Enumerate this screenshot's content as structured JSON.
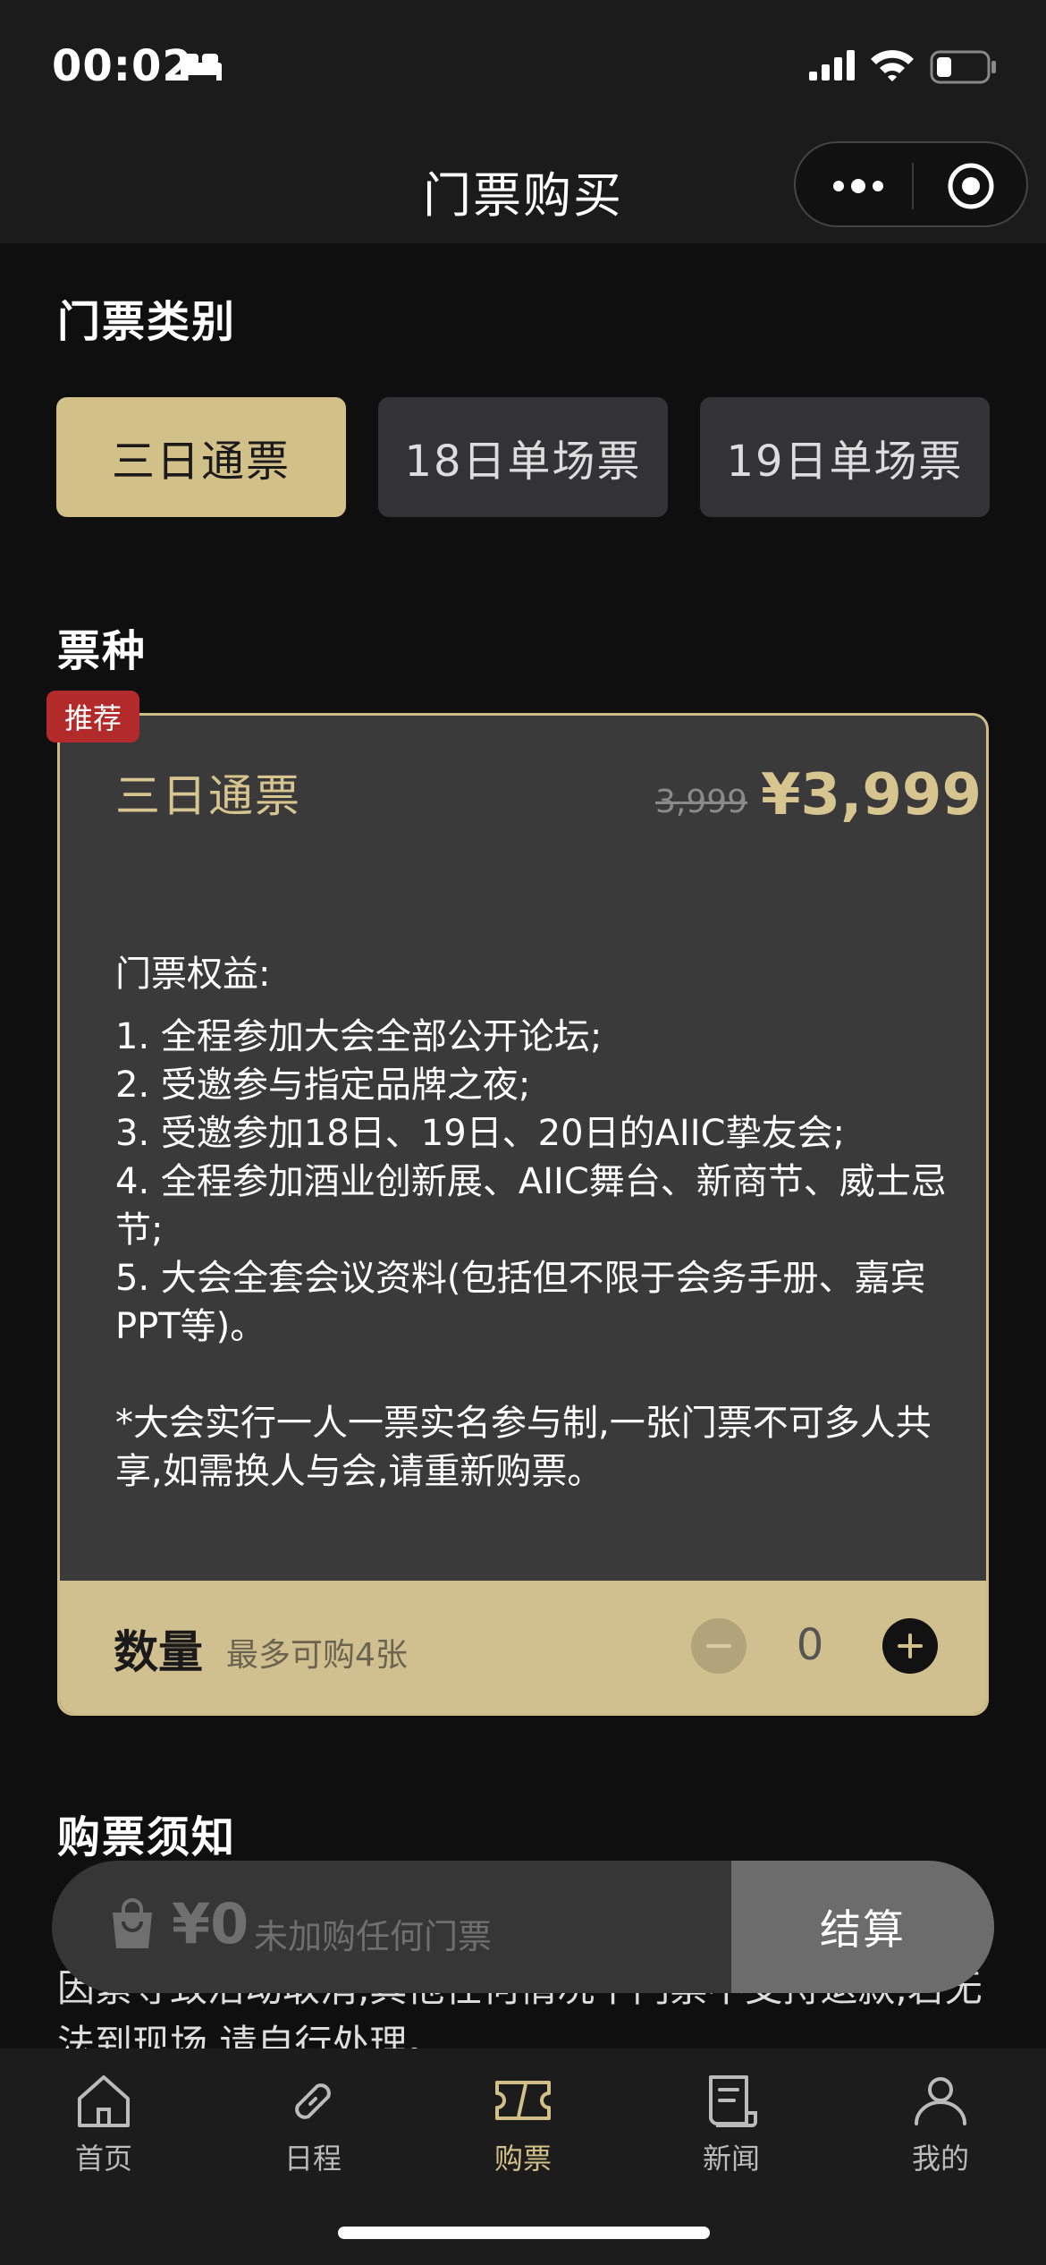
{
  "status": {
    "time": "00:02"
  },
  "nav": {
    "title": "门票购买"
  },
  "category": {
    "title": "门票类别",
    "buttons": [
      "三日通票",
      "18日单场票",
      "19日单场票"
    ]
  },
  "ticket_type": {
    "title": "票种"
  },
  "ticket": {
    "badge": "推荐",
    "name": "三日通票",
    "original_price": "3,999",
    "price": "¥3,999",
    "benefits_title": "门票权益:",
    "benefits": [
      "1. 全程参加大会全部公开论坛;",
      "2. 受邀参与指定品牌之夜;",
      "3. 受邀参加18日、19日、20日的AIIC挚友会;",
      "4. 全程参加酒业创新展、AIIC舞台、新商节、威士忌节;",
      "5. 大会全套会议资料(包括但不限于会务手册、嘉宾PPT等)。"
    ],
    "note": "*大会实行一人一票实名参与制,一张门票不可多人共享,如需换人与会,请重新购票。",
    "quantity_label": "数量",
    "quantity_limit": "最多可购4张",
    "quantity": "0"
  },
  "notice": {
    "title": "购票须知",
    "text": "因素导致活动取消,其他任何情况下门票不支持退款,若无法到现场,请自行处理。"
  },
  "checkout": {
    "total": "¥0",
    "empty_text": "未加购任何门票",
    "button": "结算"
  },
  "tabbar": {
    "items": [
      {
        "label": "首页",
        "icon": "home-icon"
      },
      {
        "label": "日程",
        "icon": "link-icon"
      },
      {
        "label": "购票",
        "icon": "ticket-icon"
      },
      {
        "label": "新闻",
        "icon": "news-icon"
      },
      {
        "label": "我的",
        "icon": "user-icon"
      }
    ],
    "active_color": "#d2c089"
  },
  "colors": {
    "accent": "#d2c089",
    "badge": "#b22a2a",
    "background": "#0f0f0f"
  }
}
